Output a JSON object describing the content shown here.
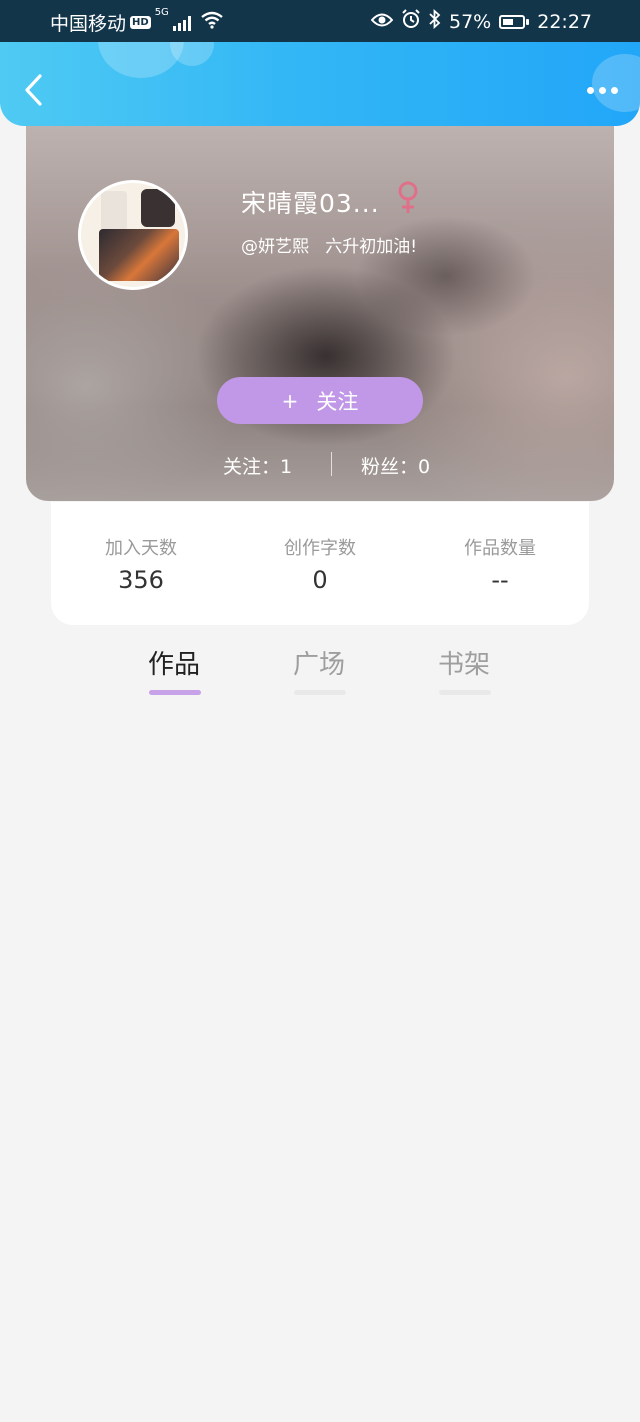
{
  "status_bar": {
    "carrier": "中国移动",
    "hd": "HD",
    "network": "5G",
    "battery": "57%",
    "battery_fraction": 0.57,
    "time": "22:27"
  },
  "header": {
    "back_icon": "chevron-left-icon",
    "more_icon": "more-dots-icon"
  },
  "profile": {
    "username": "宋晴霞03...",
    "gender": "female",
    "gender_color": "#e0708a",
    "signature": "@妍艺熙   六升初加油!",
    "follow_label": "关注",
    "follow_plus": "+",
    "following_text": "关注：1",
    "fans_text": "粉丝：0"
  },
  "stats": [
    {
      "label": "加入天数",
      "value": "356"
    },
    {
      "label": "创作字数",
      "value": "0"
    },
    {
      "label": "作品数量",
      "value": "--"
    }
  ],
  "tabs": [
    {
      "label": "作品",
      "active": true
    },
    {
      "label": "广场",
      "active": false
    },
    {
      "label": "书架",
      "active": false
    }
  ],
  "colors": {
    "header_start": "#4fcaf3",
    "header_end": "#22a6f8",
    "accent_purple": "#c198e8",
    "status_bar": "#13354a"
  }
}
